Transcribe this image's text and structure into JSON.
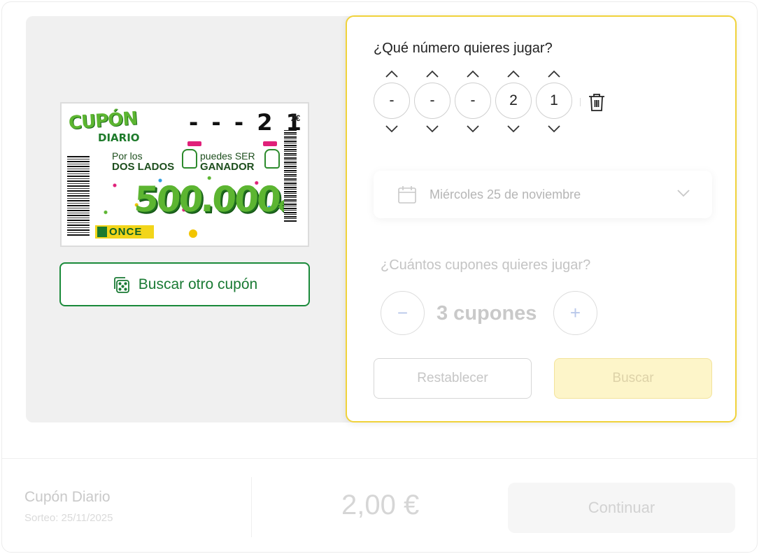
{
  "ticket": {
    "brand_line1": "CUPÓN",
    "brand_line2": "DIARIO",
    "digits": "- - - 2 1",
    "price": "2€",
    "promo_left_small": "Por los",
    "promo_left_bold": "DOS LADOS",
    "promo_right_small": "puedes SER",
    "promo_right_bold": "GANADOR",
    "prize_amount": "500.000",
    "prize_currency": "€",
    "once_logo": "ONCE"
  },
  "search_other_button": {
    "label": "Buscar otro cupón",
    "icon": "dice-icon"
  },
  "number_picker": {
    "question": "¿Qué número quieres jugar?",
    "digits": [
      "-",
      "-",
      "-",
      "2",
      "1"
    ]
  },
  "date_select": {
    "value": "Miércoles 25 de noviembre",
    "icon": "calendar-icon"
  },
  "coupons": {
    "question": "¿Cuántos cupones quieres jugar?",
    "value": "3 cupones",
    "minus_label": "−",
    "plus_label": "+"
  },
  "actions": {
    "reset_label": "Restablecer",
    "search_label": "Buscar"
  },
  "footer": {
    "product_name": "Cupón Diario",
    "draw_date": "Sorteo: 25/11/2025",
    "price": "2,00 €",
    "continue_label": "Continuar"
  },
  "colors": {
    "brand_green": "#1a8a3a",
    "highlight_yellow": "#f0d23a",
    "search_button_bg": "#fdf5c9"
  }
}
